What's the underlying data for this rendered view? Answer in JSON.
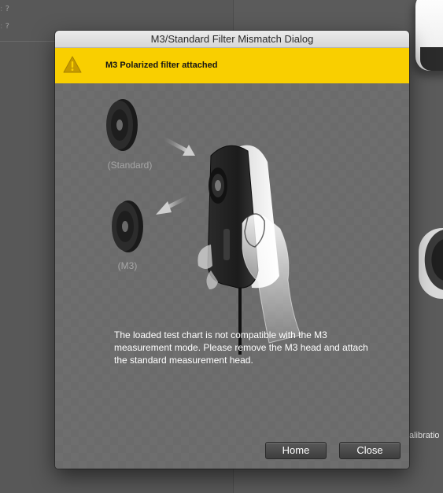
{
  "background": {
    "field_markers": [
      "?",
      "?"
    ],
    "right_text": "alibratio"
  },
  "dialog": {
    "title": "M3/Standard Filter Mismatch Dialog",
    "warning": {
      "icon": "warning-triangle-icon",
      "text": "M3 Polarized filter attached",
      "color": "#f9cf00"
    },
    "illustration": {
      "standard_label": "(Standard)",
      "m3_label": "(M3)"
    },
    "message": "The loaded test chart is not compatible with the M3 measurement mode. Please remove the M3 head and attach the standard measurement head.",
    "buttons": {
      "home": "Home",
      "close": "Close"
    }
  }
}
